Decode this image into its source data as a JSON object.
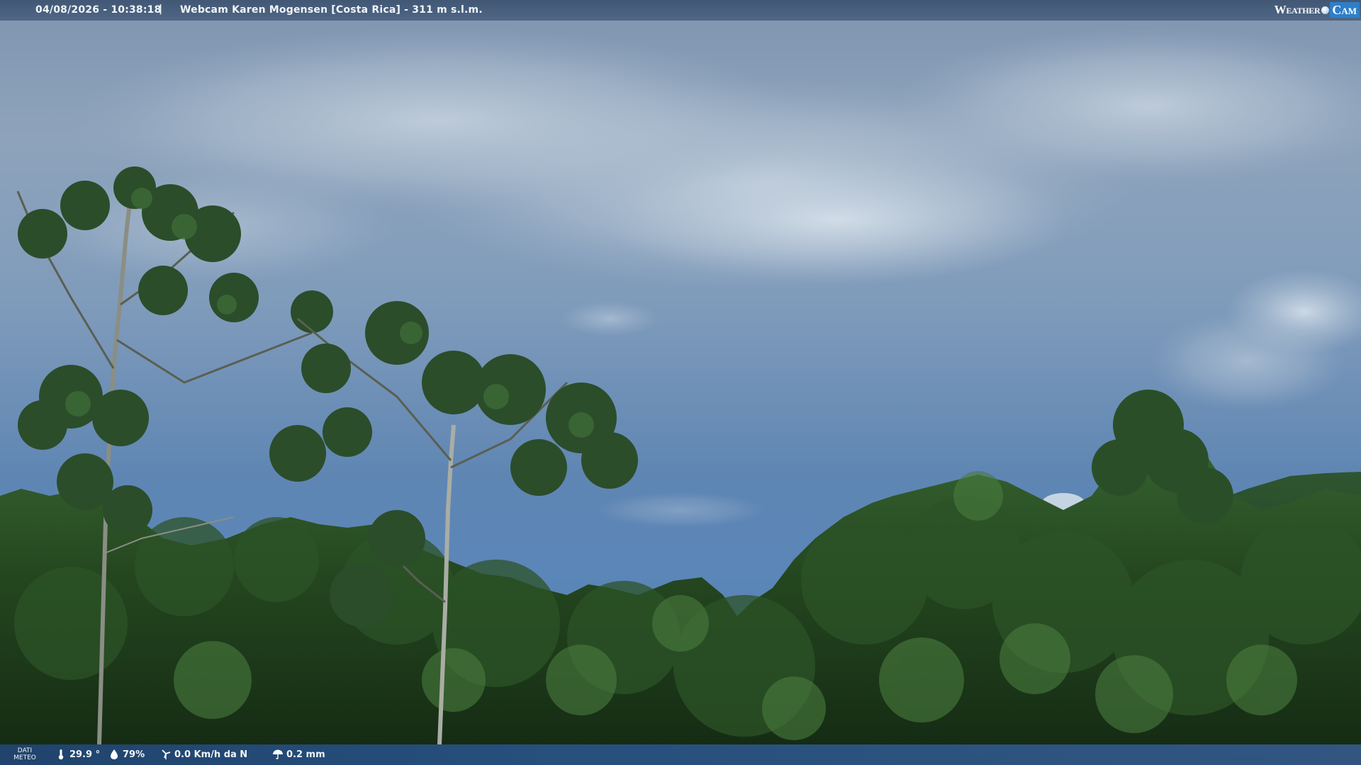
{
  "header": {
    "timestamp": "04/08/2026 - 10:38:18",
    "separator": "|",
    "title": "Webcam Karen Mogensen [Costa Rica]  - 311 m s.l.m."
  },
  "brand": {
    "weather": "Weather",
    "cam": "Cam"
  },
  "weather_data": {
    "label_line1": "DATI",
    "label_line2": "METEO",
    "temperature": "29.9 °",
    "humidity": "79%",
    "wind": "0.0 Km/h da N",
    "rain": "0.2 mm"
  },
  "colors": {
    "sky_top": "#8ea3bb",
    "sky_bottom": "#5b86b8",
    "foliage_dark": "#1f3a1c",
    "foliage_mid": "#2f5a2a",
    "brand_blue": "#2f7fc8"
  }
}
